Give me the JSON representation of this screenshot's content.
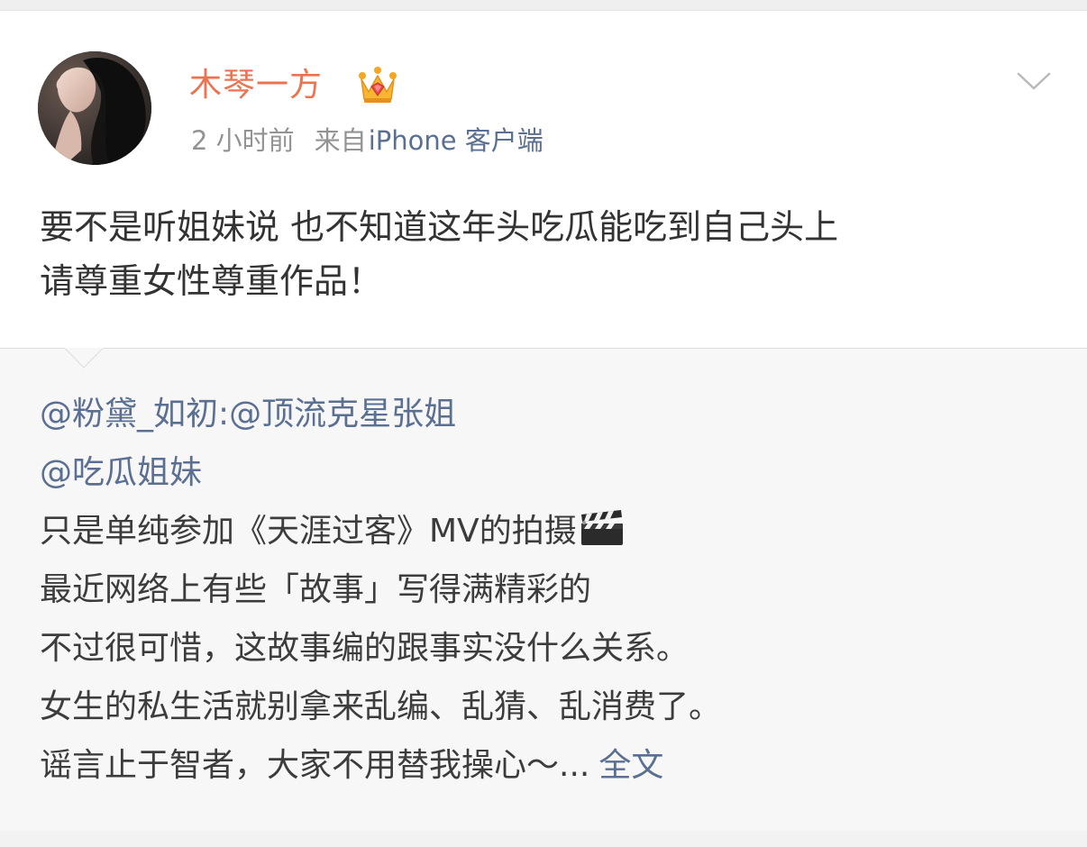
{
  "user": {
    "name": "木琴一方",
    "time": "2 小时前",
    "from_label": "来自",
    "source": "iPhone 客户端"
  },
  "post": {
    "lines": [
      "要不是听姐妹说 也不知道这年头吃瓜能吃到自己头上",
      "请尊重女性尊重作品！"
    ]
  },
  "repost": {
    "mention_1": "@粉黛_如初",
    "separator": ":",
    "mention_2": "@顶流克星张姐",
    "mention_3": "@吃瓜姐妹",
    "lines": [
      "只是单纯参加《天涯过客》MV的拍摄",
      "最近网络上有些「故事」写得满精彩的",
      "不过很可惜，这故事编的跟事实没什么关系。",
      "女生的私生活就别拿来乱编、乱猜、乱消费了。",
      "谣言止于智者，大家不用替我操心～..."
    ],
    "full_text_link": "全文"
  },
  "icons": {
    "crown": "crown-badge-icon",
    "more": "chevron-down-icon",
    "clapper": "clapperboard-emoji-icon"
  },
  "colors": {
    "username": "#eb7350",
    "link": "#5a6f91",
    "meta": "#939393",
    "body": "#333333",
    "repost_bg": "#f7f7f7"
  }
}
